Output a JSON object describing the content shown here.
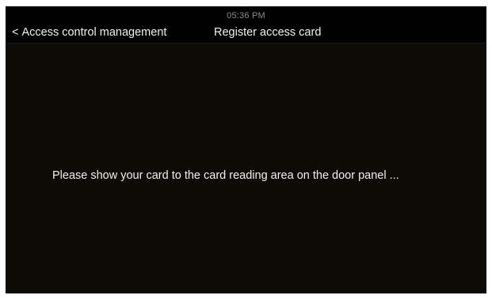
{
  "header": {
    "clock": "05:36 PM",
    "back_chevron": "<",
    "back_label": "Access control management",
    "title": "Register access card"
  },
  "main": {
    "prompt": "Please show your card to the card reading area on the door panel ..."
  },
  "colors": {
    "header_bg": "#000000",
    "content_bg": "#0e0b06",
    "text": "#f2f2f2",
    "clock_text": "#8b8b8b"
  }
}
